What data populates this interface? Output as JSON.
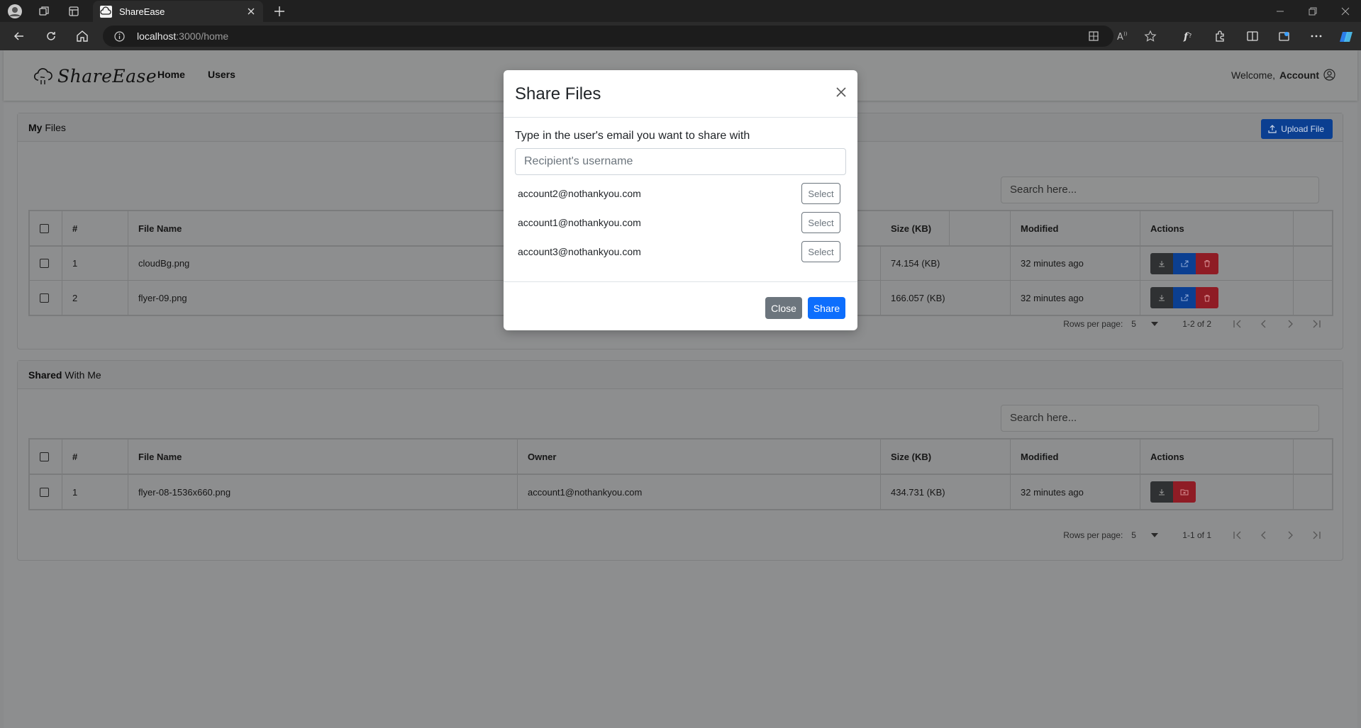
{
  "browser": {
    "tab_title": "ShareEase",
    "url_host": "localhost",
    "url_path": ":3000/home"
  },
  "app": {
    "logo_text": "ShareEase",
    "nav": {
      "home": "Home",
      "users": "Users"
    },
    "welcome": "Welcome,",
    "account": "Account"
  },
  "my_files": {
    "title_bold": "My",
    "title_rest": " Files",
    "upload_label": "Upload File",
    "search_placeholder": "Search here...",
    "columns": [
      "#",
      "File Name",
      "Size (KB)",
      "Modified",
      "Actions"
    ],
    "rows": [
      {
        "num": "1",
        "name": "cloudBg.png",
        "size": "74.154 (KB)",
        "modified": "32 minutes ago"
      },
      {
        "num": "2",
        "name": "flyer-09.png",
        "size": "166.057 (KB)",
        "modified": "32 minutes ago"
      }
    ],
    "pager": {
      "rows_label": "Rows per page:",
      "rows_value": "5",
      "range": "1-2 of 2"
    }
  },
  "shared": {
    "title_bold": "Shared",
    "title_rest": " With Me",
    "search_placeholder": "Search here...",
    "columns": [
      "#",
      "File Name",
      "Owner",
      "Size (KB)",
      "Modified",
      "Actions"
    ],
    "rows": [
      {
        "num": "1",
        "name": "flyer-08-1536x660.png",
        "owner": "account1@nothankyou.com",
        "size": "434.731 (KB)",
        "modified": "32 minutes ago"
      }
    ],
    "pager": {
      "rows_label": "Rows per page:",
      "rows_value": "5",
      "range": "1-1 of 1"
    }
  },
  "modal": {
    "title": "Share Files",
    "prompt": "Type in the user's email you want to share with",
    "input_placeholder": "Recipient's username",
    "users": [
      {
        "email": "account2@nothankyou.com",
        "select_label": "Select"
      },
      {
        "email": "account1@nothankyou.com",
        "select_label": "Select"
      },
      {
        "email": "account3@nothankyou.com",
        "select_label": "Select"
      }
    ],
    "close_label": "Close",
    "share_label": "Share"
  },
  "colors": {
    "primary": "#0d6efd",
    "secondary": "#6c757d",
    "danger": "#dc3545",
    "dark": "#212529"
  }
}
